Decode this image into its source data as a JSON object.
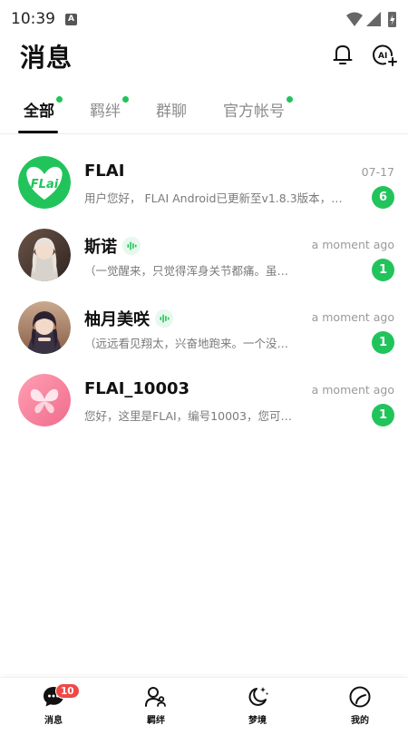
{
  "status_bar": {
    "time": "10:39",
    "notification_glyph": "A"
  },
  "header": {
    "title": "消息"
  },
  "tabs": [
    {
      "label": "全部",
      "active": true,
      "has_dot": true
    },
    {
      "label": "羁绊",
      "active": false,
      "has_dot": true
    },
    {
      "label": "群聊",
      "active": false,
      "has_dot": false
    },
    {
      "label": "官方帐号",
      "active": false,
      "has_dot": true
    }
  ],
  "chats": [
    {
      "name": "FLAI",
      "preview": "用户您好，  FLAI Android已更新至v1.8.3版本，…",
      "time": "07-17",
      "unread": "6",
      "voice": false,
      "avatar_text": "FLai"
    },
    {
      "name": "斯诺",
      "preview": "（一觉醒来，只觉得浑身关节都痛。虽…",
      "time": "a moment ago",
      "unread": "1",
      "voice": true
    },
    {
      "name": "柚月美咲",
      "preview": "（远远看见翔太，兴奋地跑来。一个没…",
      "time": "a moment ago",
      "unread": "1",
      "voice": true
    },
    {
      "name": "FLAI_10003",
      "preview": "您好，这里是FLAI，编号10003，您可…",
      "time": "a moment ago",
      "unread": "1",
      "voice": false
    }
  ],
  "bottom_nav": [
    {
      "label": "消息",
      "icon": "chat-bubble-icon",
      "badge": "10"
    },
    {
      "label": "羁绊",
      "icon": "people-icon"
    },
    {
      "label": "梦境",
      "icon": "moon-stars-icon"
    },
    {
      "label": "我的",
      "icon": "profile-circle-icon"
    }
  ],
  "colors": {
    "accent": "#21c45b",
    "badge_red": "#f04848",
    "text": "#111111",
    "muted": "#7a7a7a"
  }
}
